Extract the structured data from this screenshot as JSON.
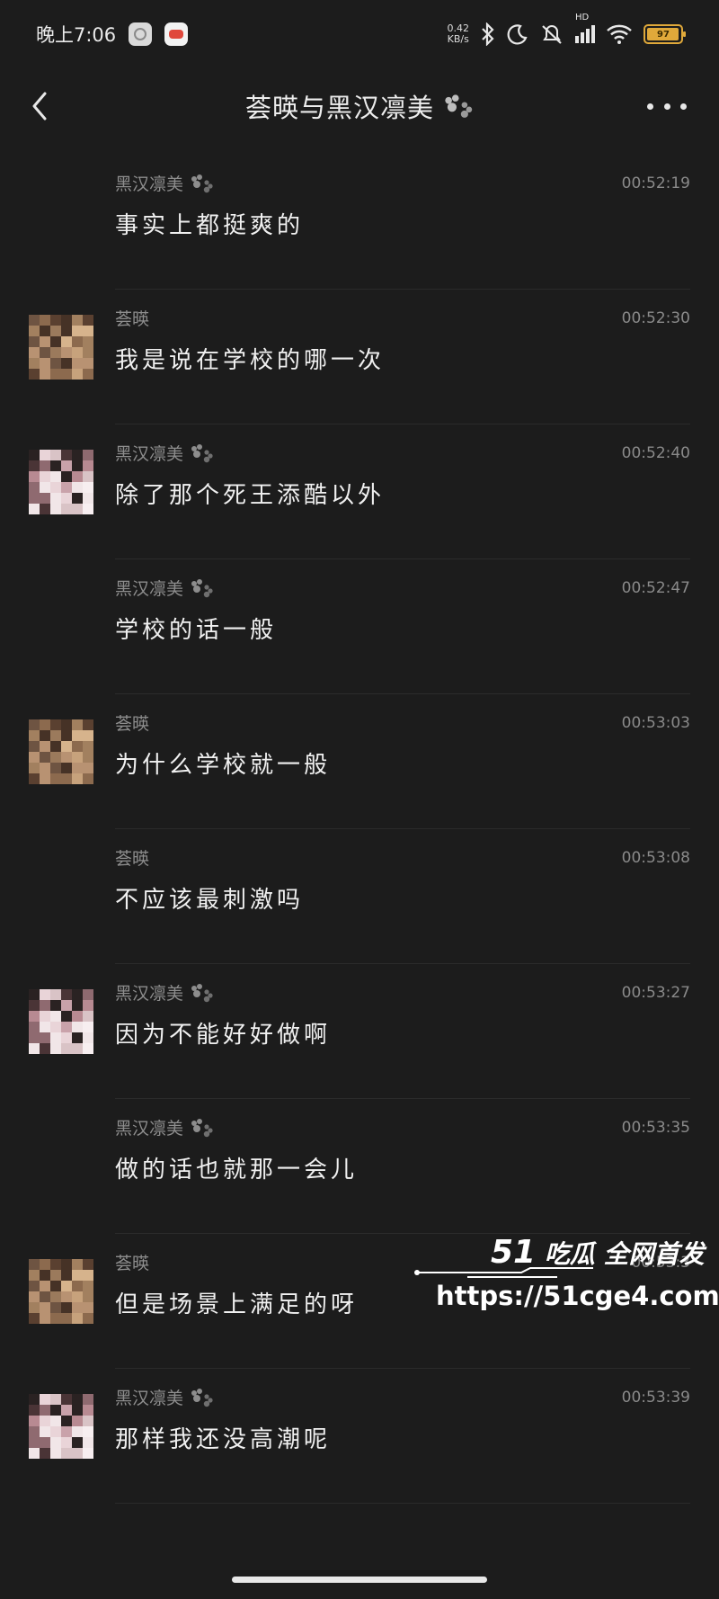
{
  "status_bar": {
    "time": "晚上7:06",
    "net_speed_value": "0.42",
    "net_speed_unit": "KB/s",
    "signal_label": "HD",
    "battery_level": "97"
  },
  "header": {
    "title": "荟暎与黑汉凛美"
  },
  "messages": [
    {
      "sender": "黑汉凛美",
      "time": "00:52:19",
      "text": "事实上都挺爽的",
      "avatar": "none"
    },
    {
      "sender": "荟暎",
      "time": "00:52:30",
      "text": "我是说在学校的哪一次",
      "avatar": "a"
    },
    {
      "sender": "黑汉凛美",
      "time": "00:52:40",
      "text": "除了那个死王添酷以外",
      "avatar": "b"
    },
    {
      "sender": "黑汉凛美",
      "time": "00:52:47",
      "text": "学校的话一般",
      "avatar": "none"
    },
    {
      "sender": "荟暎",
      "time": "00:53:03",
      "text": "为什么学校就一般",
      "avatar": "a"
    },
    {
      "sender": "荟暎",
      "time": "00:53:08",
      "text": "不应该最刺激吗",
      "avatar": "none"
    },
    {
      "sender": "黑汉凛美",
      "time": "00:53:27",
      "text": "因为不能好好做啊",
      "avatar": "b"
    },
    {
      "sender": "黑汉凛美",
      "time": "00:53:35",
      "text": "做的话也就那一会儿",
      "avatar": "none"
    },
    {
      "sender": "荟暎",
      "time": "00:53:3",
      "text": "但是场景上满足的呀",
      "avatar": "a"
    },
    {
      "sender": "黑汉凛美",
      "time": "00:53:39",
      "text": "那样我还没高潮呢",
      "avatar": "b"
    }
  ],
  "watermark": {
    "brand_number": "51",
    "brand_text": "吃瓜 全网首发",
    "url": "https://51cge4.com"
  },
  "colors": {
    "background": "#1c1c1c",
    "text": "#f0f0f0",
    "muted": "#8a8a8a",
    "battery": "#e0a93a"
  }
}
